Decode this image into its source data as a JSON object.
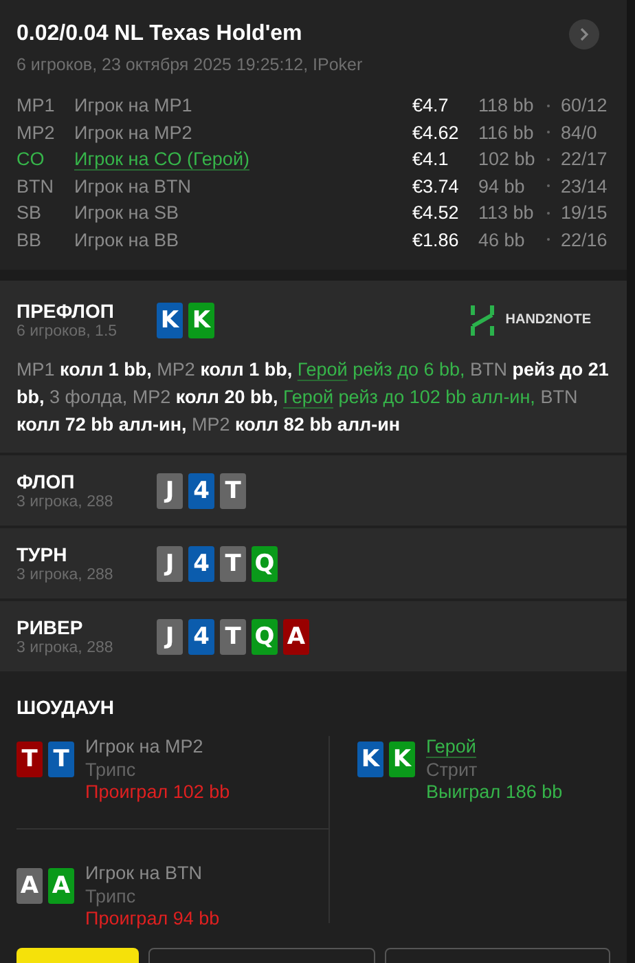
{
  "header": {
    "title": "0.02/0.04 NL Texas Hold'em",
    "subtitle": "6 игроков, 23 октября 2025 19:25:12, IPoker"
  },
  "players": [
    {
      "position": "MP1",
      "name": "Игрок на MP1",
      "hero": false,
      "stack": "€4.7",
      "bb": "118 bb",
      "stats": "60/12"
    },
    {
      "position": "MP2",
      "name": "Игрок на MP2",
      "hero": false,
      "stack": "€4.62",
      "bb": "116 bb",
      "stats": "84/0"
    },
    {
      "position": "CO",
      "name": "Игрок на CO (Герой)",
      "hero": true,
      "stack": "€4.1",
      "bb": "102 bb",
      "stats": "22/17"
    },
    {
      "position": "BTN",
      "name": "Игрок на BTN",
      "hero": false,
      "stack": "€3.74",
      "bb": "94 bb",
      "stats": "23/14"
    },
    {
      "position": "SB",
      "name": "Игрок на SB",
      "hero": false,
      "stack": "€4.52",
      "bb": "113 bb",
      "stats": "19/15"
    },
    {
      "position": "BB",
      "name": "Игрок на BB",
      "hero": false,
      "stack": "€1.86",
      "bb": "46 bb",
      "stats": "22/16"
    }
  ],
  "preflop": {
    "title": "ПРЕФЛОП",
    "subtitle": "6 игроков, 1.5",
    "cards": [
      {
        "rank": "K",
        "color": "#0b5cad"
      },
      {
        "rank": "K",
        "color": "#0a9a1a"
      }
    ],
    "logo": "HAND2NOTE",
    "actions": [
      {
        "kind": "pos",
        "text": "MP1 "
      },
      {
        "kind": "act",
        "text": "колл 1 bb, "
      },
      {
        "kind": "pos",
        "text": "MP2 "
      },
      {
        "kind": "act",
        "text": "колл 1 bb, "
      },
      {
        "kind": "hero",
        "text": "Герой"
      },
      {
        "kind": "heroact",
        "text": " рейз до 6 bb, "
      },
      {
        "kind": "pos",
        "text": "BTN "
      },
      {
        "kind": "act",
        "text": "рейз до 21 bb, "
      },
      {
        "kind": "pos",
        "text": "3 фолда, MP2 "
      },
      {
        "kind": "act",
        "text": "колл 20 bb, "
      },
      {
        "kind": "hero",
        "text": "Герой"
      },
      {
        "kind": "heroact",
        "text": " рейз до 102 bb алл-ин, "
      },
      {
        "kind": "pos",
        "text": "BTN "
      },
      {
        "kind": "act",
        "text": "колл 72 bb алл-ин, "
      },
      {
        "kind": "pos",
        "text": "MP2 "
      },
      {
        "kind": "act",
        "text": "колл 82 bb алл-ин"
      }
    ]
  },
  "streets": [
    {
      "title": "ФЛОП",
      "subtitle": "3 игрока, 288",
      "cards": [
        {
          "rank": "J",
          "color": "#666666"
        },
        {
          "rank": "4",
          "color": "#0b5cad"
        },
        {
          "rank": "T",
          "color": "#666666"
        }
      ]
    },
    {
      "title": "ТУРН",
      "subtitle": "3 игрока, 288",
      "cards": [
        {
          "rank": "J",
          "color": "#666666"
        },
        {
          "rank": "4",
          "color": "#0b5cad"
        },
        {
          "rank": "T",
          "color": "#666666"
        },
        {
          "rank": "Q",
          "color": "#0a9a1a"
        }
      ]
    },
    {
      "title": "РИВЕР",
      "subtitle": "3 игрока, 288",
      "cards": [
        {
          "rank": "J",
          "color": "#666666"
        },
        {
          "rank": "4",
          "color": "#0b5cad"
        },
        {
          "rank": "T",
          "color": "#666666"
        },
        {
          "rank": "Q",
          "color": "#0a9a1a"
        },
        {
          "rank": "A",
          "color": "#990000"
        }
      ]
    }
  ],
  "showdown": {
    "title": "ШОУДАУН",
    "hands": [
      {
        "name": "Игрок на MP2",
        "hero": false,
        "combo": "Трипс",
        "result": "Проиграл 102 bb",
        "won": false,
        "cards": [
          {
            "rank": "T",
            "color": "#990000"
          },
          {
            "rank": "T",
            "color": "#0b5cad"
          }
        ]
      },
      {
        "name": "Герой",
        "hero": true,
        "combo": "Стрит",
        "result": "Выиграл 186 bb",
        "won": true,
        "cards": [
          {
            "rank": "K",
            "color": "#0b5cad"
          },
          {
            "rank": "K",
            "color": "#0a9a1a"
          }
        ]
      },
      {
        "name": "Игрок на BTN",
        "hero": false,
        "combo": "Трипс",
        "result": "Проиграл 94 bb",
        "won": false,
        "cards": [
          {
            "rank": "A",
            "color": "#666666"
          },
          {
            "rank": "A",
            "color": "#0a9a1a"
          }
        ]
      }
    ]
  },
  "bottom_buttons": [
    {
      "kind": "primary"
    },
    {
      "kind": "secondary"
    },
    {
      "kind": "secondary"
    }
  ]
}
